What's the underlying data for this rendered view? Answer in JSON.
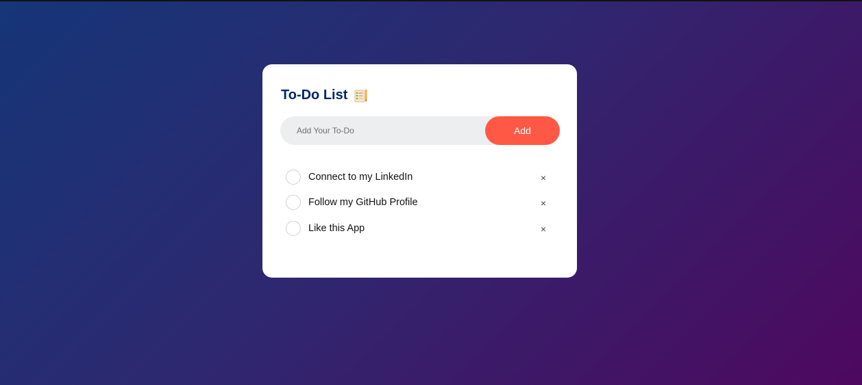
{
  "app": {
    "title": "To-Do List",
    "title_icon": "checklist-notepad-icon"
  },
  "input": {
    "placeholder": "Add Your To-Do",
    "value": ""
  },
  "add_button": {
    "label": "Add"
  },
  "todos": [
    {
      "text": "Connect to my LinkedIn",
      "checked": false,
      "delete_label": "×"
    },
    {
      "text": "Follow my GitHub Profile",
      "checked": false,
      "delete_label": "×"
    },
    {
      "text": "Like this App",
      "checked": false,
      "delete_label": "×"
    }
  ],
  "colors": {
    "background_start": "#153677",
    "background_end": "#4e085f",
    "title": "#002765",
    "accent": "#ff5945",
    "input_bg": "#edeef0"
  }
}
